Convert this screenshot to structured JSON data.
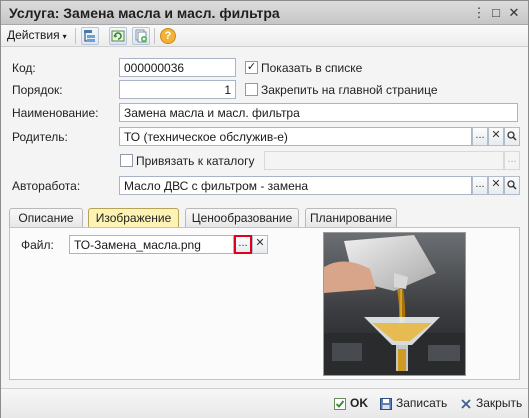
{
  "window": {
    "title": "Услуга: Замена масла и масл. фильтра",
    "dots_button": "⋮",
    "maximize_button": "□",
    "close_button": "✕"
  },
  "toolbar": {
    "actions_label": "Действия",
    "actions_arrow": "▾",
    "help_label": "?"
  },
  "form": {
    "code_label": "Код:",
    "code_value": "000000036",
    "order_label": "Порядок:",
    "order_value": "1",
    "name_label": "Наименование:",
    "name_value": "Замена масла и масл. фильтра",
    "parent_label": "Родитель:",
    "parent_value": "ТО (техническое обслужив-е)",
    "autowork_label": "Авторабота:",
    "autowork_value": "Масло ДВС с фильтром - замена",
    "catalog_value": "",
    "show_in_list_label": "Показать в списке",
    "show_in_list_checked": true,
    "pin_main_label": "Закрепить на главной странице",
    "pin_main_checked": false,
    "link_catalog_label": "Привязать к каталогу",
    "link_catalog_checked": false,
    "select_glyph": "...",
    "clear_glyph": "✕"
  },
  "tabs": [
    {
      "label": "Описание",
      "active": false
    },
    {
      "label": "Изображение",
      "active": true
    },
    {
      "label": "Ценообразование",
      "active": false
    },
    {
      "label": "Планирование",
      "active": false
    }
  ],
  "image_tab": {
    "file_label": "Файл:",
    "file_value": "ТО-Замена_масла.png",
    "highlight_color": "#e0001a"
  },
  "footer": {
    "ok_label": "OK",
    "save_label": "Записать",
    "close_label": "Закрыть"
  },
  "colors": {
    "active_tab": "#fdf3b4",
    "title_bar": "#d0d0d0"
  },
  "icons": {
    "check": "✓",
    "search": "search-icon"
  }
}
